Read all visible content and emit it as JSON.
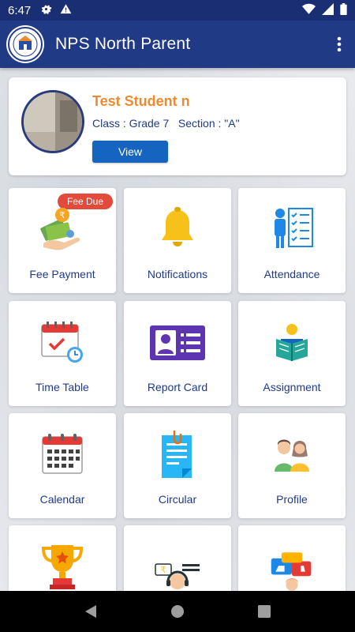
{
  "status_bar": {
    "time": "6:47",
    "icons": [
      "settings-icon",
      "warning-icon",
      "wifi-icon",
      "signal-icon",
      "battery-icon"
    ]
  },
  "app_bar": {
    "title": "NPS North Parent",
    "logo": "school-logo",
    "menu_icon": "more-vert-icon"
  },
  "profile": {
    "name": "Test Student n",
    "class_info": "Class : Grade 7   Section : \"A\"",
    "view_label": "View"
  },
  "tiles": [
    {
      "label": "Fee Payment",
      "icon": "fee-payment-icon",
      "badge": "Fee Due"
    },
    {
      "label": "Notifications",
      "icon": "bell-icon"
    },
    {
      "label": "Attendance",
      "icon": "attendance-checklist-icon"
    },
    {
      "label": "Time Table",
      "icon": "timetable-calendar-icon"
    },
    {
      "label": "Report Card",
      "icon": "report-card-icon"
    },
    {
      "label": "Assignment",
      "icon": "assignment-reading-icon"
    },
    {
      "label": "Calendar",
      "icon": "calendar-icon"
    },
    {
      "label": "Circular",
      "icon": "circular-document-icon"
    },
    {
      "label": "Profile",
      "icon": "profile-people-icon"
    },
    {
      "label": "",
      "icon": "trophy-icon"
    },
    {
      "label": "",
      "icon": "support-agent-icon"
    },
    {
      "label": "",
      "icon": "feedback-icon"
    }
  ],
  "colors": {
    "app_bar": "#213a86",
    "status_bar": "#1a2f73",
    "accent_name": "#ee8a2d",
    "button": "#1565c0",
    "label_text": "#1f3a8a",
    "badge": "#e24b3b"
  },
  "nav_bar": {
    "buttons": [
      "back-icon",
      "home-icon",
      "recents-icon"
    ]
  }
}
